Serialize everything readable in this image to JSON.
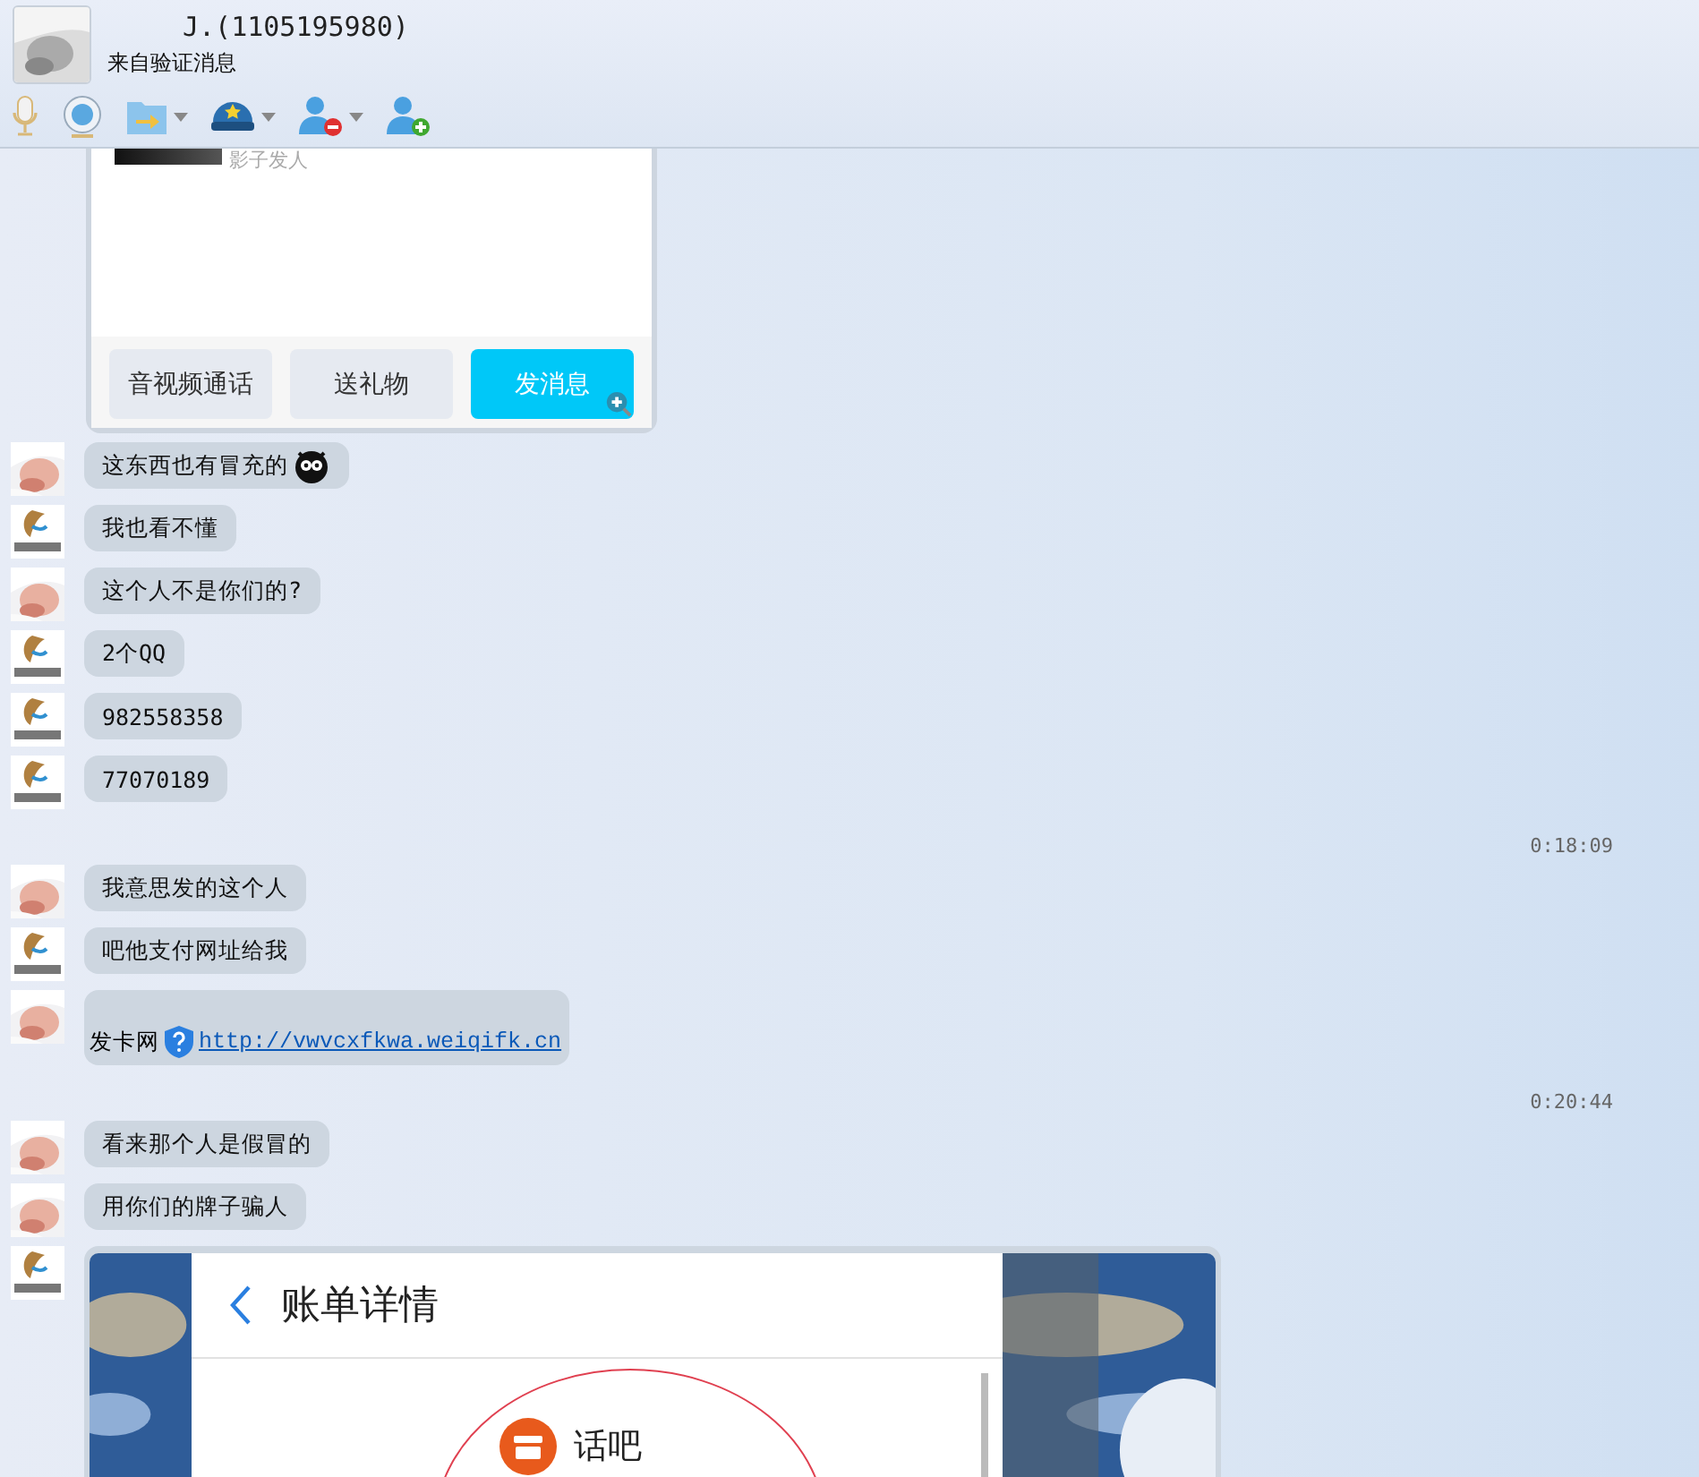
{
  "header": {
    "name": "J.(1105195980)",
    "subtitle": "来自验证消息"
  },
  "toolbar": [
    {
      "kind": "mic",
      "dropdown": false
    },
    {
      "kind": "camera",
      "dropdown": false
    },
    {
      "kind": "file",
      "dropdown": true
    },
    {
      "kind": "hat",
      "dropdown": true
    },
    {
      "kind": "remove",
      "dropdown": true
    },
    {
      "kind": "add",
      "dropdown": false
    }
  ],
  "card": {
    "caption": "影子发人",
    "buttons": [
      {
        "label": "音视频通话",
        "selected": false
      },
      {
        "label": "送礼物",
        "selected": false
      },
      {
        "label": "发消息",
        "selected": true
      }
    ]
  },
  "messages": [
    {
      "kind": "text",
      "avatar": {
        "kind": "baby"
      },
      "text": "这东西也有冒充的",
      "emoji": true
    },
    {
      "kind": "text",
      "avatar": {
        "kind": "logo"
      },
      "text": "我也看不懂"
    },
    {
      "kind": "text",
      "avatar": {
        "kind": "baby"
      },
      "text": "这个人不是你们的?"
    },
    {
      "kind": "text",
      "avatar": {
        "kind": "logo"
      },
      "text": "2个QQ"
    },
    {
      "kind": "text",
      "avatar": {
        "kind": "logo"
      },
      "text": "982558358"
    },
    {
      "kind": "text",
      "avatar": {
        "kind": "logo"
      },
      "text": "77070189"
    },
    {
      "kind": "time",
      "text": "0:18:09"
    },
    {
      "kind": "text",
      "avatar": {
        "kind": "baby"
      },
      "text": "我意思发的这个人"
    },
    {
      "kind": "text",
      "avatar": {
        "kind": "logo"
      },
      "text": "吧他支付网址给我"
    },
    {
      "kind": "link",
      "avatar": {
        "kind": "baby"
      },
      "text": "发卡网",
      "url": "http://vwvcxfkwa.weiqifk.cn"
    },
    {
      "kind": "time",
      "text": "0:20:44"
    },
    {
      "kind": "text",
      "avatar": {
        "kind": "baby"
      },
      "text": "看来那个人是假冒的"
    },
    {
      "kind": "text",
      "avatar": {
        "kind": "baby"
      },
      "text": "用你们的牌子骗人"
    },
    {
      "avatar": {
        "kind": "logo"
      },
      "title": "账单详情",
      "merchant": "话吧"
    }
  ]
}
